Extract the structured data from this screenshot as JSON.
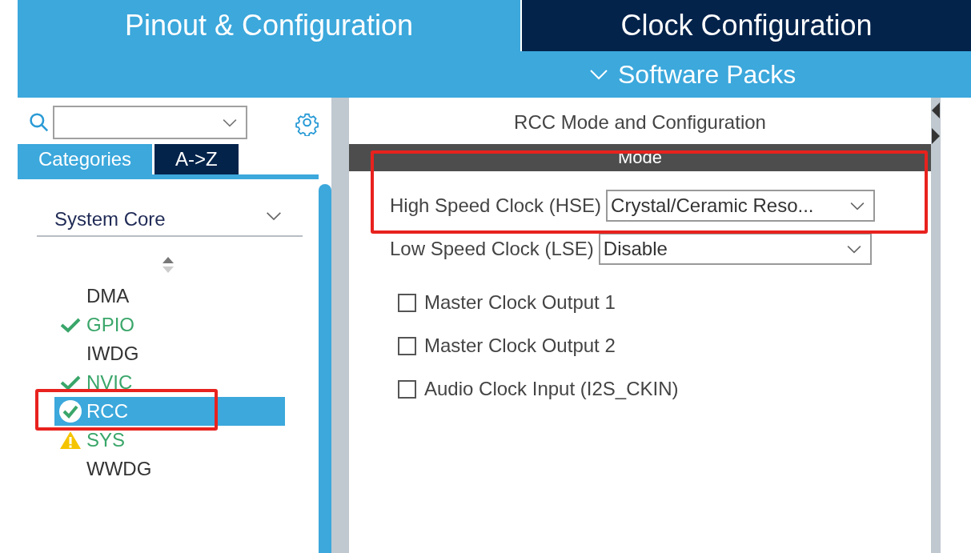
{
  "top_tabs": [
    {
      "label": "Pinout & Configuration",
      "selected": true
    },
    {
      "label": "Clock Configuration",
      "selected": false
    }
  ],
  "menu": {
    "label": "Software Packs"
  },
  "left_panel": {
    "tabs": [
      {
        "label": "Categories",
        "selected": true
      },
      {
        "label": "A->Z",
        "selected": false
      }
    ],
    "category": {
      "label": "System Core",
      "expanded": true
    },
    "items": [
      {
        "label": "DMA",
        "kind": "plain",
        "selected": false
      },
      {
        "label": "GPIO",
        "kind": "ok",
        "selected": false
      },
      {
        "label": "IWDG",
        "kind": "plain",
        "selected": false
      },
      {
        "label": "NVIC",
        "kind": "ok",
        "selected": false
      },
      {
        "label": "RCC",
        "kind": "done",
        "selected": true
      },
      {
        "label": "SYS",
        "kind": "warning",
        "selected": false
      },
      {
        "label": "WWDG",
        "kind": "plain",
        "selected": false
      }
    ]
  },
  "panel": {
    "title": "RCC Mode and Configuration",
    "section": "Mode",
    "selects": [
      {
        "label": "High Speed Clock (HSE)",
        "value": "Crystal/Ceramic Reso..."
      },
      {
        "label": "Low Speed Clock (LSE)",
        "value": "Disable"
      }
    ],
    "checkboxes": [
      {
        "label": "Master Clock Output 1",
        "checked": false
      },
      {
        "label": "Master Clock Output 2",
        "checked": false
      },
      {
        "label": "Audio Clock Input (I2S_CKIN)",
        "checked": false
      }
    ]
  }
}
